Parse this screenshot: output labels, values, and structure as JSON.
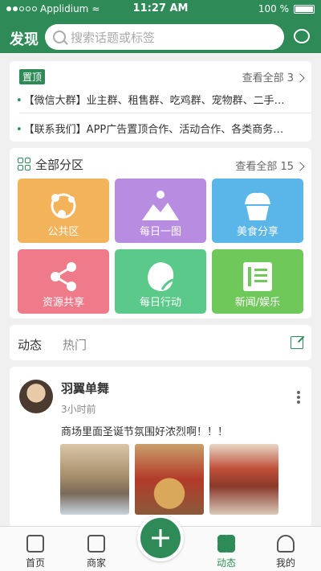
{
  "status_bar": {
    "carrier": "Applidium",
    "time": "11:27 AM",
    "battery": "100 %"
  },
  "header": {
    "title": "发现",
    "search_placeholder": "搜索话题或标签"
  },
  "pinned": {
    "tag": "置顶",
    "more_label": "查看全部 3",
    "items": [
      "【微信大群】业主群、租售群、吃鸡群、宠物群、二手…",
      "【联系我们】APP广告置顶合作、活动合作、各类商务…"
    ]
  },
  "categories": {
    "title": "全部分区",
    "more_label": "查看全部 15",
    "items": [
      {
        "label": "公共区",
        "color": "#f3b35a",
        "icon": "network-icon"
      },
      {
        "label": "每日一图",
        "color": "#b88ce0",
        "icon": "image-icon"
      },
      {
        "label": "美食分享",
        "color": "#5ab6e8",
        "icon": "cupcake-icon"
      },
      {
        "label": "资源共享",
        "color": "#ef7a8a",
        "icon": "share-icon"
      },
      {
        "label": "每日行动",
        "color": "#5bc98a",
        "icon": "leaf-icon"
      },
      {
        "label": "新闻/娱乐",
        "color": "#6fc85a",
        "icon": "news-icon"
      }
    ]
  },
  "feed_tabs": {
    "active": "动态",
    "inactive": "热门"
  },
  "post": {
    "author": "羽翼单舞",
    "time": "3小时前",
    "text": "商场里面圣诞节氛围好浓烈啊！！！"
  },
  "tabbar": {
    "items": [
      "首页",
      "商家",
      "动态",
      "我的"
    ]
  },
  "colors": {
    "brand": "#2e8b57"
  }
}
